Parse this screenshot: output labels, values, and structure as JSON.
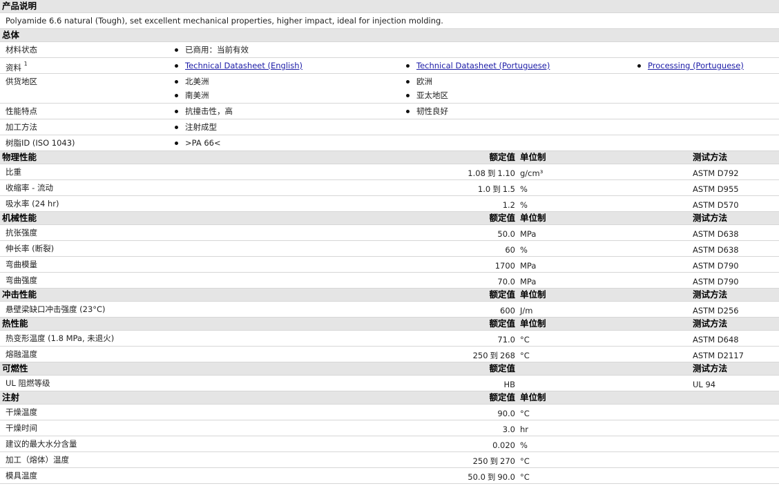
{
  "description": {
    "title": "产品说明",
    "text": "Polyamide 6.6 natural (Tough), set excellent mechanical properties, higher impact, ideal for injection molding."
  },
  "general": {
    "title": "总体",
    "rows": [
      {
        "label": "材料状态",
        "items": [
          "已商用：当前有效"
        ]
      },
      {
        "label": "资料",
        "sup": "1",
        "items": [
          "Technical Datasheet (English)",
          "Technical Datasheet (Portuguese)",
          "Processing (Portuguese)"
        ],
        "links": true
      },
      {
        "label": "供货地区",
        "items": [
          "北美洲",
          "欧洲",
          "南美洲",
          "亚太地区"
        ]
      },
      {
        "label": "性能特点",
        "items": [
          "抗撞击性，高",
          "韧性良好"
        ]
      },
      {
        "label": "加工方法",
        "items": [
          "注射成型"
        ]
      },
      {
        "label": "树脂ID (ISO 1043)",
        "items": [
          ">PA 66<"
        ]
      }
    ]
  },
  "headers": {
    "nominal": "额定值",
    "unit": "单位制",
    "method": "测试方法"
  },
  "range_word": "到",
  "sections": [
    {
      "title": "物理性能",
      "show_unit": true,
      "show_method": true,
      "rows": [
        {
          "label": "比重",
          "v1": "1.08",
          "v2": "1.10",
          "unit": "g/cm³",
          "method": "ASTM D792"
        },
        {
          "label": "收缩率 - 流动",
          "v1": "1.0",
          "v2": "1.5",
          "unit": "%",
          "method": "ASTM D955"
        },
        {
          "label": "吸水率 (24 hr)",
          "v1": "1.2",
          "unit": "%",
          "method": "ASTM D570"
        }
      ]
    },
    {
      "title": "机械性能",
      "show_unit": true,
      "show_method": true,
      "rows": [
        {
          "label": "抗张强度",
          "v1": "50.0",
          "unit": "MPa",
          "method": "ASTM D638"
        },
        {
          "label": "伸长率 (断裂)",
          "v1": "60",
          "unit": "%",
          "method": "ASTM D638"
        },
        {
          "label": "弯曲模量",
          "v1": "1700",
          "unit": "MPa",
          "method": "ASTM D790"
        },
        {
          "label": "弯曲强度",
          "v1": "70.0",
          "unit": "MPa",
          "method": "ASTM D790"
        }
      ]
    },
    {
      "title": "冲击性能",
      "show_unit": true,
      "show_method": true,
      "rows": [
        {
          "label": "悬壁梁缺口冲击强度 (23°C)",
          "v1": "600",
          "unit": "J/m",
          "method": "ASTM D256"
        }
      ]
    },
    {
      "title": "热性能",
      "show_unit": true,
      "show_method": true,
      "rows": [
        {
          "label": "热变形温度 (1.8 MPa, 未退火)",
          "v1": "71.0",
          "unit": "°C",
          "method": "ASTM D648"
        },
        {
          "label": "熔融温度",
          "v1": "250",
          "v2": "268",
          "unit": "°C",
          "method": "ASTM D2117"
        }
      ]
    },
    {
      "title": "可燃性",
      "show_unit": false,
      "show_method": true,
      "rows": [
        {
          "label": "UL 阻燃等级",
          "v1": "HB",
          "unit": "",
          "method": "UL 94"
        }
      ]
    },
    {
      "title": "注射",
      "show_unit": true,
      "show_method": false,
      "rows": [
        {
          "label": "干燥温度",
          "v1": "90.0",
          "unit": "°C",
          "method": ""
        },
        {
          "label": "干燥时间",
          "v1": "3.0",
          "unit": "hr",
          "method": ""
        },
        {
          "label": "建议的最大水分含量",
          "v1": "0.020",
          "unit": "%",
          "method": ""
        },
        {
          "label": "加工（熔体）温度",
          "v1": "250",
          "v2": "270",
          "unit": "°C",
          "method": ""
        },
        {
          "label": "模具温度",
          "v1": "50.0",
          "v2": "90.0",
          "unit": "°C",
          "method": ""
        }
      ]
    }
  ]
}
